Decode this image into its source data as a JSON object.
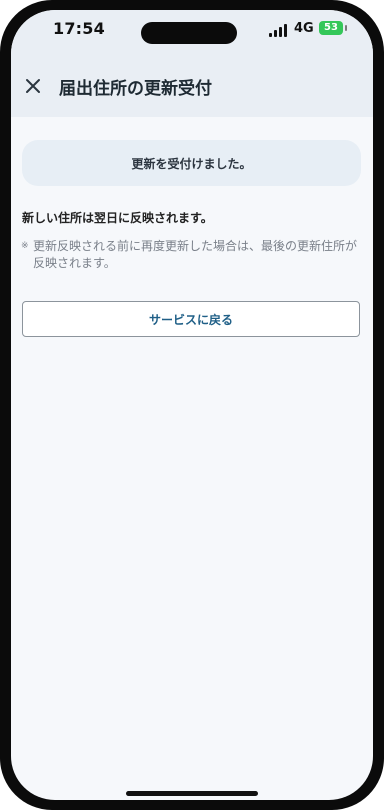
{
  "status_bar": {
    "time": "17:54",
    "network": "4G",
    "battery": "53"
  },
  "app_bar": {
    "close_icon": "close-icon",
    "title": "届出住所の更新受付"
  },
  "main": {
    "notice": "更新を受付けました。",
    "info": "新しい住所は翌日に反映されます。",
    "note_mark": "※",
    "note": "更新反映される前に再度更新した場合は、最後の更新住所が反映されます。",
    "back_button": "サービスに戻る"
  },
  "colors": {
    "header_bg": "#e9eef4",
    "page_bg": "#f6f8fb",
    "button_text": "#1f5f87",
    "battery": "#34c759"
  }
}
